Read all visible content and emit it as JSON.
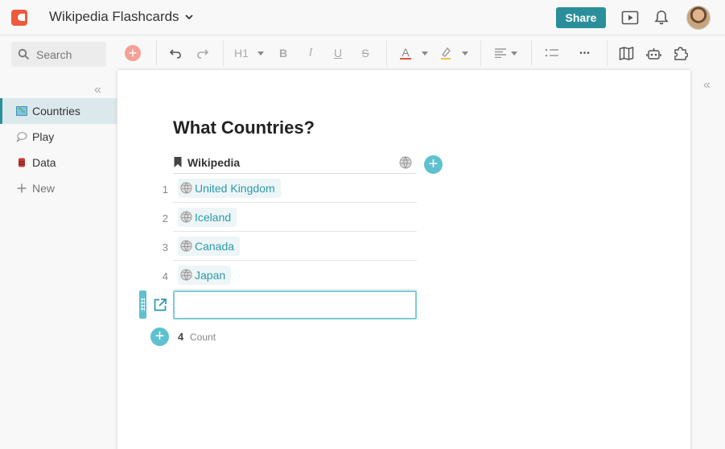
{
  "header": {
    "doc_title": "Wikipedia Flashcards",
    "share_label": "Share",
    "icons": [
      "play-icon",
      "bell-icon",
      "avatar"
    ]
  },
  "toolbar": {
    "search_placeholder": "Search",
    "heading_label": "H1",
    "bold_label": "B",
    "italic_label": "I",
    "underline_label": "U",
    "strike_label": "S",
    "text_color_label": "A",
    "more_label": "•••",
    "icons": [
      "add-icon",
      "undo-icon",
      "redo-icon",
      "text-color-icon",
      "highlight-icon",
      "align-icon",
      "list-icon",
      "more-icon",
      "map-icon",
      "robot-icon",
      "puzzle-icon"
    ]
  },
  "sidebar": {
    "items": [
      {
        "label": "Countries",
        "icon": "map-emoji-icon",
        "active": true
      },
      {
        "label": "Play",
        "icon": "speech-bubble-icon",
        "active": false
      },
      {
        "label": "Data",
        "icon": "database-icon",
        "active": false
      },
      {
        "label": "New",
        "icon": "plus-icon",
        "active": false
      }
    ]
  },
  "page": {
    "title": "What Countries?",
    "table": {
      "column": "Wikipedia",
      "rows": [
        {
          "num": "1",
          "value": "United Kingdom"
        },
        {
          "num": "2",
          "value": "Iceland"
        },
        {
          "num": "3",
          "value": "Canada"
        },
        {
          "num": "4",
          "value": "Japan"
        }
      ],
      "new_row_value": "",
      "count_value": "4",
      "count_label": "Count"
    }
  },
  "colors": {
    "accent": "#2a8f9a",
    "accent_light": "#5fc1cf",
    "brand": "#ee5a3c",
    "link": "#2a9aab",
    "text_color_underline": "#e0533c",
    "highlight_underline": "#f2c14e"
  }
}
